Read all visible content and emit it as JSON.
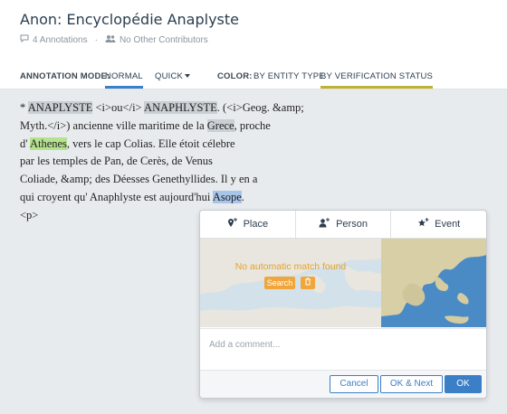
{
  "header": {
    "title": "Anon: Encyclopédie Anaplyste",
    "annotations": "4 Annotations",
    "contributors": "No Other Contributors",
    "comment_icon": "comment-icon",
    "users_icon": "users-icon"
  },
  "toolbar": {
    "mode_label": "ANNOTATION MODE:",
    "normal": "NORMAL",
    "quick": "QUICK",
    "color_label": "COLOR:",
    "by_entity": "BY ENTITY TYPE",
    "by_status": "BY VERIFICATION STATUS"
  },
  "text": {
    "l1_a": "* ",
    "l1_b": "ANAPLYSTE",
    "l1_c": " <i>ou</i> ",
    "l1_d": "ANAPHLYSTE",
    "l1_e": ". (<i>Geog. &amp;",
    "l2_a": "Myth.</i>) ancienne ville maritime de la ",
    "l2_b": "Grece",
    "l2_c": ", proche",
    "l3_a": "d' ",
    "l3_b": "Athenes",
    "l3_c": ", vers le cap Colias. Elle étoit célebre",
    "l4": "par les temples de Pan, de Cerès, de Venus",
    "l5": "Coliade, &amp; des Déesses Genethyllides. Il y en a",
    "l6_a": "qui croyent qu' Anaphlyste est aujourd'hui ",
    "l6_b": "Asope",
    "l6_c": ".",
    "l7": "<p>"
  },
  "popup": {
    "tab_place": "Place",
    "tab_person": "Person",
    "tab_event": "Event",
    "no_match": "No automatic match found",
    "search": "Search",
    "comment_placeholder": "Add a comment...",
    "cancel": "Cancel",
    "ok_next": "OK & Next",
    "ok": "OK"
  },
  "colors": {
    "accent": "#3b7fc6",
    "olive": "#c0b236",
    "orange": "#f0a63a"
  }
}
